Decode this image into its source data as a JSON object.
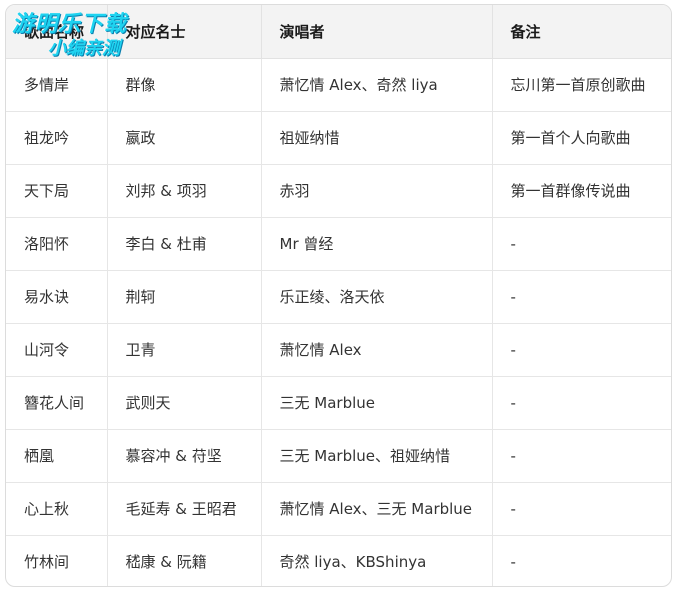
{
  "table": {
    "headers": [
      "歌曲名称",
      "对应名士",
      "演唱者",
      "备注"
    ],
    "rows": [
      [
        "多情岸",
        "群像",
        "萧忆情 Alex、奇然 liya",
        "忘川第一首原创歌曲"
      ],
      [
        "祖龙吟",
        "嬴政",
        "祖娅纳惜",
        "第一首个人向歌曲"
      ],
      [
        "天下局",
        "刘邦 & 项羽",
        "赤羽",
        "第一首群像传说曲"
      ],
      [
        "洛阳怀",
        "李白 & 杜甫",
        "Mr 曾经",
        "-"
      ],
      [
        "易水诀",
        "荆轲",
        "乐正绫、洛天依",
        "-"
      ],
      [
        "山河令",
        "卫青",
        "萧忆情 Alex",
        "-"
      ],
      [
        "簪花人间",
        "武则天",
        "三无 Marblue",
        "-"
      ],
      [
        "栖凰",
        "慕容冲 & 苻坚",
        "三无 Marblue、祖娅纳惜",
        "-"
      ],
      [
        "心上秋",
        "毛延寿 & 王昭君",
        "萧忆情 Alex、三无 Marblue",
        "-"
      ],
      [
        "竹林间",
        "嵇康 & 阮籍",
        "奇然 liya、KBShinya",
        "-"
      ]
    ]
  },
  "watermark": {
    "line1": "游明乐下载",
    "line2": "小编亲测"
  }
}
